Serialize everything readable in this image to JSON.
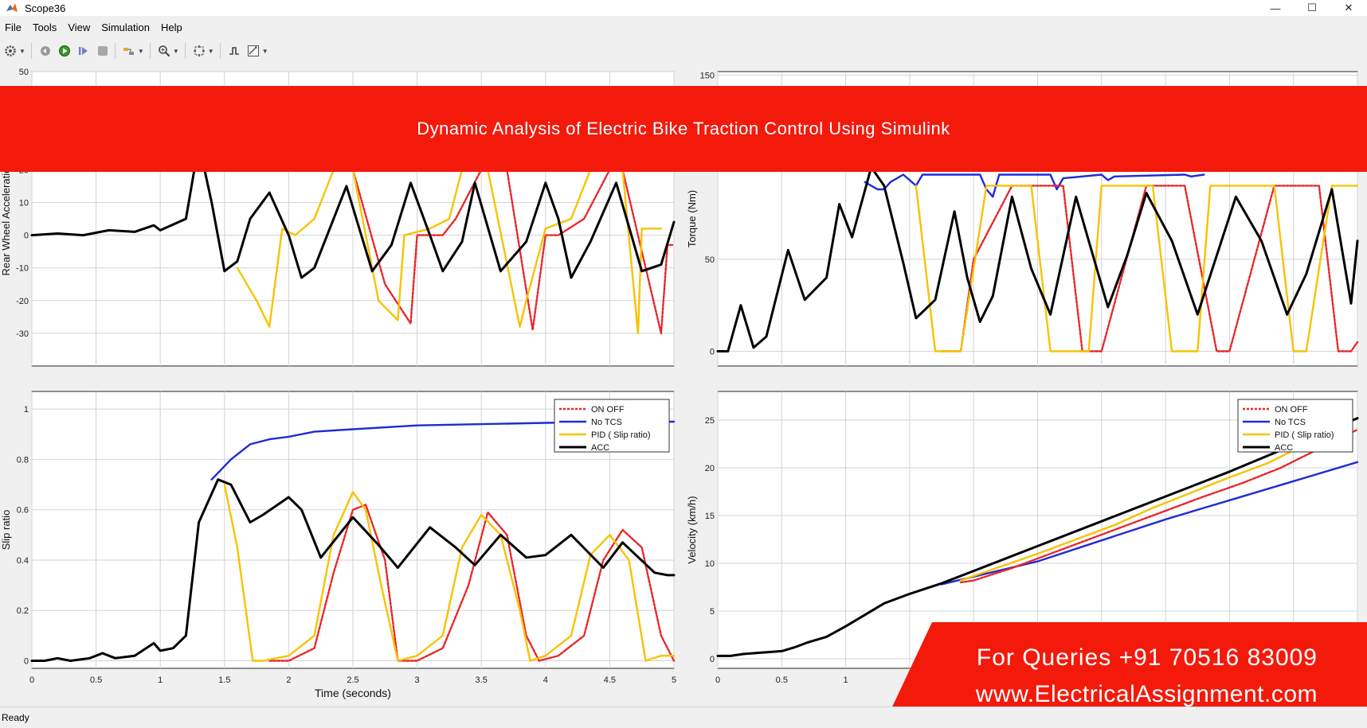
{
  "window": {
    "title": "Scope36",
    "minimize": "—",
    "maximize": "☐",
    "close": "✕"
  },
  "menu": [
    "File",
    "Tools",
    "View",
    "Simulation",
    "Help"
  ],
  "toolbar": {
    "icons": [
      "settings-icon",
      "restore-icon",
      "run-icon",
      "step-forward-icon",
      "stop-icon",
      "highlight-icon",
      "zoom-in-icon",
      "fit-to-view-icon",
      "triggers-icon",
      "measurements-icon"
    ]
  },
  "banner": {
    "text": "Dynamic Analysis of Electric Bike Traction Control Using Simulink"
  },
  "contact": {
    "phone": "For Queries +91 70516 83009",
    "website": "www.ElectricalAssignment.com"
  },
  "status": {
    "text": "Ready"
  },
  "colors": {
    "on_off": "#e8262a",
    "no_tcs": "#1f2bd6",
    "pid": "#f7c300",
    "acc": "#000000",
    "banner": "#f31a0c"
  },
  "chart_data": [
    {
      "type": "line",
      "id": "acceleration",
      "ylabel": "Rear Wheel Acceleration",
      "xlabel": "",
      "xlim": [
        0,
        5
      ],
      "ylim": [
        -40,
        50
      ],
      "xticks": [
        0,
        0.5,
        1,
        1.5,
        2,
        2.5,
        3,
        3.5,
        4,
        4.5,
        5
      ],
      "yticks": [
        -30,
        -20,
        -10,
        0,
        10,
        20,
        50
      ],
      "xtick_labels": [],
      "legend": false,
      "series": [
        {
          "key": "acc",
          "x": [
            0,
            0.2,
            0.4,
            0.6,
            0.8,
            0.95,
            1.0,
            1.2,
            1.3,
            1.4,
            1.5,
            1.6,
            1.7,
            1.85,
            2.0,
            2.1,
            2.2,
            2.45,
            2.65,
            2.8,
            2.95,
            3.1,
            3.2,
            3.35,
            3.45,
            3.65,
            3.85,
            4.0,
            4.1,
            4.2,
            4.35,
            4.55,
            4.75,
            4.9,
            5.0
          ],
          "y": [
            0,
            0.5,
            0,
            1.5,
            1,
            3,
            1.5,
            5,
            28,
            10,
            -11,
            -8,
            5,
            13,
            0,
            -13,
            -10,
            15,
            -11,
            -3,
            16,
            0,
            -11,
            -2,
            16,
            -11,
            -2,
            16,
            5,
            -13,
            -2,
            16,
            -11,
            -9,
            4
          ]
        },
        {
          "key": "pid",
          "x": [
            1.6,
            1.75,
            1.85,
            1.95,
            2.05,
            2.2,
            2.35,
            2.5,
            2.7,
            2.85,
            2.9,
            3.1,
            3.25,
            3.35,
            3.55,
            3.8,
            3.85,
            4.0,
            4.2,
            4.35,
            4.6,
            4.72,
            4.75,
            4.9
          ],
          "y": [
            -10,
            -20,
            -28,
            2,
            0,
            5,
            20,
            20,
            -20,
            -26,
            0,
            2,
            5,
            20,
            20,
            -28,
            -20,
            2,
            5,
            20,
            20,
            -30,
            2,
            2
          ]
        },
        {
          "key": "on_off",
          "x": [
            2.5,
            2.75,
            2.95,
            3.0,
            3.2,
            3.3,
            3.5,
            3.7,
            3.9,
            4.0,
            4.1,
            4.3,
            4.5,
            4.6,
            4.9,
            4.95,
            5.0
          ],
          "y": [
            20,
            -15,
            -27,
            0,
            0,
            5,
            20,
            20,
            -29,
            0,
            0,
            5,
            20,
            20,
            -30,
            -3,
            -3
          ]
        },
        {
          "key": "no_tcs",
          "x": [
            1.42,
            1.45,
            1.52
          ],
          "y": [
            20,
            20,
            21
          ]
        }
      ]
    },
    {
      "type": "line",
      "id": "torque",
      "ylabel": "Torque (Nm)",
      "xlabel": "",
      "xlim": [
        0,
        5
      ],
      "ylim": [
        -8,
        152
      ],
      "xticks": [
        0,
        0.5,
        1,
        1.5,
        2,
        2.5,
        3,
        3.5,
        4,
        4.5,
        5
      ],
      "yticks": [
        0,
        50,
        150
      ],
      "xtick_labels": [],
      "legend": false,
      "series": [
        {
          "key": "acc",
          "x": [
            0,
            0.08,
            0.18,
            0.28,
            0.38,
            0.55,
            0.68,
            0.85,
            0.95,
            1.05,
            1.2,
            1.3,
            1.45,
            1.55,
            1.7,
            1.85,
            1.95,
            2.05,
            2.15,
            2.3,
            2.45,
            2.6,
            2.8,
            2.9,
            3.05,
            3.2,
            3.35,
            3.55,
            3.75,
            3.9,
            4.05,
            4.25,
            4.45,
            4.6,
            4.8,
            4.95,
            5.0
          ],
          "y": [
            0,
            0,
            25,
            2,
            8,
            55,
            28,
            40,
            80,
            62,
            100,
            90,
            48,
            18,
            28,
            76,
            40,
            16,
            30,
            84,
            45,
            20,
            84,
            60,
            24,
            52,
            86,
            60,
            20,
            52,
            84,
            60,
            20,
            42,
            88,
            26,
            60
          ]
        },
        {
          "key": "no_tcs",
          "x": [
            1.15,
            1.2,
            1.25,
            1.3,
            1.35,
            1.45,
            1.5,
            1.55,
            1.6,
            2.05,
            2.1,
            2.15,
            2.2,
            2.6,
            2.65,
            2.7,
            3.0,
            3.05,
            3.1,
            3.65,
            3.7,
            3.8
          ],
          "y": [
            92,
            90,
            88,
            88,
            92,
            96,
            93,
            90,
            96,
            96,
            88,
            84,
            96,
            96,
            88,
            94,
            96,
            93,
            95,
            96,
            95,
            96
          ]
        },
        {
          "key": "pid",
          "x": [
            1.55,
            1.7,
            1.9,
            2.1,
            2.3,
            2.45,
            2.6,
            2.9,
            3.0,
            3.15,
            3.4,
            3.55,
            3.75,
            3.85,
            4.05,
            4.35,
            4.5,
            4.6,
            4.8,
            4.9,
            5.0
          ],
          "y": [
            90,
            0,
            0,
            90,
            90,
            90,
            0,
            0,
            90,
            90,
            90,
            0,
            0,
            90,
            90,
            90,
            0,
            0,
            90,
            90,
            90
          ]
        },
        {
          "key": "on_off",
          "x": [
            1.75,
            1.9,
            2.0,
            2.3,
            2.5,
            2.7,
            2.85,
            3.0,
            3.35,
            3.5,
            3.65,
            3.9,
            4.0,
            4.35,
            4.5,
            4.7,
            4.85,
            4.95,
            5.0
          ],
          "y": [
            0,
            0,
            50,
            90,
            90,
            90,
            0,
            0,
            90,
            90,
            90,
            0,
            0,
            90,
            90,
            90,
            0,
            0,
            5
          ]
        }
      ]
    },
    {
      "type": "line",
      "id": "slip",
      "ylabel": "Slip ratio",
      "xlabel": "Time (seconds)",
      "xlim": [
        0,
        5
      ],
      "ylim": [
        -0.03,
        1.07
      ],
      "xticks": [
        0,
        0.5,
        1,
        1.5,
        2,
        2.5,
        3,
        3.5,
        4,
        4.5,
        5
      ],
      "yticks": [
        0,
        0.2,
        0.4,
        0.6,
        0.8,
        1
      ],
      "xtick_labels": [
        "0",
        "0.5",
        "1",
        "1.5",
        "2",
        "2.5",
        "3",
        "3.5",
        "4",
        "4.5",
        "5"
      ],
      "ytick_labels": [
        "0",
        "0.2",
        "0.4",
        "0.6",
        "0.8",
        "1"
      ],
      "legend": true,
      "legend_entries": [
        "ON OFF",
        "No TCS",
        "PID ( Slip ratio)",
        "ACC"
      ],
      "series": [
        {
          "key": "acc",
          "x": [
            0,
            0.1,
            0.2,
            0.3,
            0.45,
            0.55,
            0.65,
            0.8,
            0.95,
            1.0,
            1.1,
            1.2,
            1.3,
            1.45,
            1.55,
            1.7,
            1.8,
            2.0,
            2.1,
            2.25,
            2.5,
            2.7,
            2.85,
            3.1,
            3.3,
            3.45,
            3.65,
            3.85,
            4.0,
            4.2,
            4.45,
            4.6,
            4.85,
            4.95,
            5.0
          ],
          "y": [
            0,
            0,
            0.01,
            0,
            0.01,
            0.03,
            0.01,
            0.02,
            0.07,
            0.04,
            0.05,
            0.1,
            0.55,
            0.72,
            0.7,
            0.55,
            0.58,
            0.65,
            0.6,
            0.41,
            0.57,
            0.46,
            0.37,
            0.53,
            0.45,
            0.38,
            0.5,
            0.41,
            0.42,
            0.5,
            0.37,
            0.47,
            0.35,
            0.34,
            0.34
          ]
        },
        {
          "key": "no_tcs",
          "x": [
            1.4,
            1.55,
            1.7,
            1.85,
            2.0,
            2.2,
            2.5,
            3.0,
            3.5,
            4.0,
            4.5,
            5.0
          ],
          "y": [
            0.72,
            0.8,
            0.86,
            0.88,
            0.89,
            0.91,
            0.92,
            0.935,
            0.94,
            0.945,
            0.95,
            0.95
          ]
        },
        {
          "key": "pid",
          "x": [
            1.5,
            1.6,
            1.72,
            1.8,
            2.0,
            2.2,
            2.35,
            2.5,
            2.6,
            2.72,
            2.85,
            3.0,
            3.2,
            3.35,
            3.5,
            3.65,
            3.8,
            3.88,
            4.0,
            4.2,
            4.35,
            4.5,
            4.65,
            4.78,
            4.9,
            5.0
          ],
          "y": [
            0.7,
            0.45,
            0,
            0,
            0.02,
            0.1,
            0.5,
            0.67,
            0.6,
            0.3,
            0,
            0.02,
            0.1,
            0.45,
            0.58,
            0.5,
            0.2,
            0,
            0.02,
            0.1,
            0.42,
            0.5,
            0.4,
            0,
            0.02,
            0.02
          ]
        },
        {
          "key": "on_off",
          "x": [
            1.85,
            2.0,
            2.2,
            2.35,
            2.5,
            2.6,
            2.75,
            2.85,
            3.0,
            3.2,
            3.4,
            3.55,
            3.7,
            3.85,
            3.95,
            4.1,
            4.3,
            4.45,
            4.6,
            4.75,
            4.9,
            5.0
          ],
          "y": [
            0,
            0,
            0.05,
            0.35,
            0.6,
            0.62,
            0.4,
            0,
            0,
            0.05,
            0.3,
            0.59,
            0.5,
            0.1,
            0,
            0.02,
            0.1,
            0.4,
            0.52,
            0.45,
            0.1,
            0
          ]
        }
      ]
    },
    {
      "type": "line",
      "id": "velocity",
      "ylabel": "Velocity (km/h)",
      "xlabel": "",
      "xlim": [
        0,
        5
      ],
      "ylim": [
        -1,
        28
      ],
      "xticks": [
        0,
        0.5,
        1,
        1.5,
        2,
        2.5,
        3,
        3.5,
        4,
        4.5,
        5
      ],
      "yticks": [
        0,
        5,
        10,
        15,
        20,
        25
      ],
      "xtick_labels": [
        "0",
        "0.5",
        "1"
      ],
      "ytick_labels": [
        "0",
        "5",
        "10",
        "15",
        "20",
        "25"
      ],
      "legend": true,
      "legend_entries": [
        "ON OFF",
        "No TCS",
        "PID ( Slip ratio)",
        "ACC"
      ],
      "series": [
        {
          "key": "no_tcs",
          "x": [
            1.75,
            2.5,
            3.0,
            3.5,
            4.0,
            4.5,
            5.0
          ],
          "y": [
            7.8,
            10.2,
            12.4,
            14.6,
            16.6,
            18.6,
            20.6
          ]
        },
        {
          "key": "on_off",
          "x": [
            1.9,
            2.0,
            2.3,
            2.6,
            2.9,
            3.2,
            3.5,
            3.8,
            4.1,
            4.4,
            4.7,
            5.0
          ],
          "y": [
            8,
            8.2,
            9.5,
            11,
            12.5,
            14,
            15.5,
            17,
            18.4,
            20,
            22,
            24
          ]
        },
        {
          "key": "pid",
          "x": [
            1.9,
            2.2,
            2.5,
            2.8,
            3.1,
            3.4,
            3.7,
            4.0,
            4.3,
            4.6,
            5.0
          ],
          "y": [
            8.2,
            9.6,
            11,
            12.5,
            14,
            15.8,
            17.4,
            19,
            20.5,
            22.5,
            25.2
          ]
        },
        {
          "key": "acc",
          "x": [
            0,
            0.1,
            0.2,
            0.3,
            0.5,
            0.6,
            0.7,
            0.85,
            1.0,
            1.15,
            1.3,
            1.5,
            1.75,
            2.0,
            2.5,
            3.0,
            3.5,
            4.0,
            4.5,
            5.0
          ],
          "y": [
            0.3,
            0.3,
            0.5,
            0.6,
            0.8,
            1.2,
            1.7,
            2.3,
            3.4,
            4.6,
            5.8,
            6.8,
            7.9,
            9.2,
            11.8,
            14.4,
            17,
            19.6,
            22.4,
            25.2
          ]
        }
      ]
    }
  ]
}
